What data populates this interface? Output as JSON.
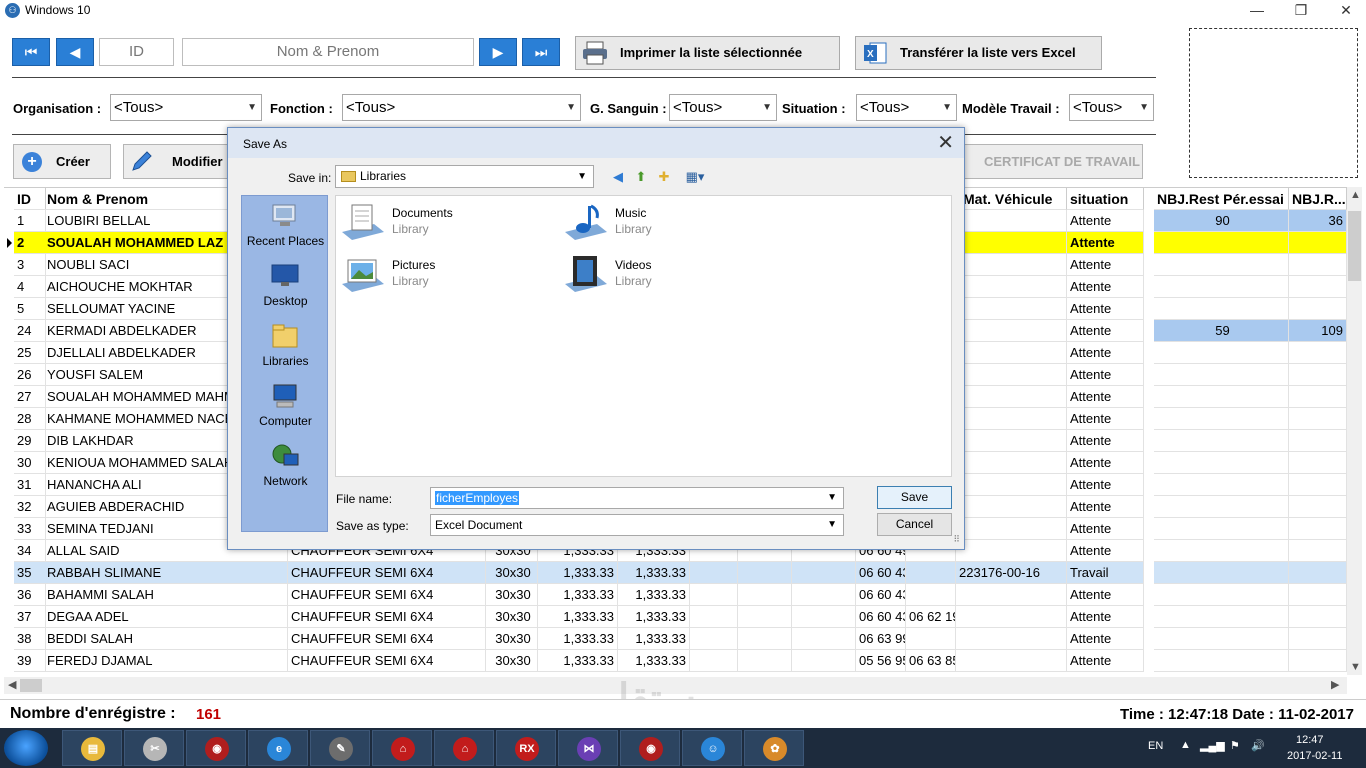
{
  "window": {
    "title": "Windows 10"
  },
  "nav": {
    "id_placeholder": "ID",
    "name_placeholder": "Nom & Prenom"
  },
  "toolbar": {
    "print_label": "Imprimer la liste sélectionnée",
    "excel_label": "Transférer la liste vers Excel"
  },
  "filters": [
    {
      "label": "Organisation :",
      "value": "<Tous>"
    },
    {
      "label": "Fonction :",
      "value": "<Tous>"
    },
    {
      "label": "G. Sanguin :",
      "value": "<Tous>"
    },
    {
      "label": "Situation :",
      "value": "<Tous>"
    },
    {
      "label": "Modèle Travail :",
      "value": "<Tous>"
    }
  ],
  "actions": {
    "create": "Créer",
    "modify": "Modifier",
    "certificate": "CERTIFICAT DE TRAVAIL"
  },
  "grid": {
    "headers": [
      "ID",
      "Nom & Prenom",
      "Mat. Véhicule",
      "situation",
      "NBJ.Rest Pér.essai",
      "NBJ.R..."
    ],
    "rows": [
      {
        "id": "1",
        "name": "LOUBIRI BELLAL",
        "fn": "",
        "size": "",
        "a": "",
        "b": "",
        "tel1": "",
        "tel2": "",
        "mat": "",
        "sit": "Attente",
        "n1": "90",
        "n2": "36"
      },
      {
        "id": "2",
        "name": "SOUALAH MOHAMMED LAZ",
        "fn": "",
        "size": "",
        "a": "",
        "b": "",
        "tel1": "",
        "tel2": "",
        "mat": "",
        "sit": "Attente",
        "n1": "",
        "n2": ""
      },
      {
        "id": "3",
        "name": "NOUBLI  SACI",
        "fn": "",
        "size": "",
        "a": "",
        "b": "",
        "tel1": "",
        "tel2": "",
        "mat": "",
        "sit": "Attente",
        "n1": "",
        "n2": ""
      },
      {
        "id": "4",
        "name": "AICHOUCHE MOKHTAR",
        "fn": "",
        "size": "",
        "a": "",
        "b": "",
        "tel1": "",
        "tel2": "",
        "mat": "",
        "sit": "Attente",
        "n1": "",
        "n2": ""
      },
      {
        "id": "5",
        "name": "SELLOUMAT YACINE",
        "fn": "",
        "size": "",
        "a": "",
        "b": "",
        "tel1": "",
        "tel2": "",
        "mat": "",
        "sit": "Attente",
        "n1": "",
        "n2": ""
      },
      {
        "id": "24",
        "name": "KERMADI  ABDELKADER",
        "fn": "",
        "size": "",
        "a": "",
        "b": "",
        "tel1": "",
        "tel2": "",
        "mat": "",
        "sit": "Attente",
        "n1": "59",
        "n2": "109"
      },
      {
        "id": "25",
        "name": "DJELLALI ABDELKADER",
        "fn": "",
        "size": "",
        "a": "",
        "b": "",
        "tel1": "",
        "tel2": "",
        "mat": "",
        "sit": "Attente",
        "n1": "",
        "n2": ""
      },
      {
        "id": "26",
        "name": "YOUSFI  SALEM",
        "fn": "",
        "size": "",
        "a": "",
        "b": "",
        "tel1": "",
        "tel2": "",
        "mat": "",
        "sit": "Attente",
        "n1": "",
        "n2": ""
      },
      {
        "id": "27",
        "name": "SOUALAH MOHAMMED MAHM",
        "fn": "",
        "size": "",
        "a": "",
        "b": "",
        "tel1": "",
        "tel2": "",
        "mat": "",
        "sit": "Attente",
        "n1": "",
        "n2": ""
      },
      {
        "id": "28",
        "name": "KAHMANE  MOHAMMED NACE",
        "fn": "",
        "size": "",
        "a": "",
        "b": "",
        "tel1": "",
        "tel2": "",
        "mat": "",
        "sit": "Attente",
        "n1": "",
        "n2": ""
      },
      {
        "id": "29",
        "name": "DIB LAKHDAR",
        "fn": "",
        "size": "",
        "a": "",
        "b": "",
        "tel1": "",
        "tel2": "",
        "mat": "",
        "sit": "Attente",
        "n1": "",
        "n2": ""
      },
      {
        "id": "30",
        "name": "KENIOUA MOHAMMED SALAH",
        "fn": "",
        "size": "",
        "a": "",
        "b": "",
        "tel1": "",
        "tel2": "",
        "mat": "",
        "sit": "Attente",
        "n1": "",
        "n2": ""
      },
      {
        "id": "31",
        "name": "HANANCHA ALI",
        "fn": "",
        "size": "",
        "a": "",
        "b": "",
        "tel1": "",
        "tel2": "",
        "mat": "",
        "sit": "Attente",
        "n1": "",
        "n2": ""
      },
      {
        "id": "32",
        "name": "AGUIEB ABDERACHID",
        "fn": "",
        "size": "",
        "a": "",
        "b": "",
        "tel1": "",
        "tel2": "",
        "mat": "",
        "sit": "Attente",
        "n1": "",
        "n2": ""
      },
      {
        "id": "33",
        "name": "SEMINA TEDJANI",
        "fn": "",
        "size": "",
        "a": "",
        "b": "",
        "tel1": "",
        "tel2": "",
        "mat": "",
        "sit": "Attente",
        "n1": "",
        "n2": ""
      },
      {
        "id": "34",
        "name": "ALLAL SAID",
        "fn": "CHAUFFEUR SEMI 6X4",
        "size": "30x30",
        "a": "1,333.33",
        "b": "1,333.33",
        "tel1": "06 60 49",
        "tel2": "",
        "mat": "",
        "sit": "Attente",
        "n1": "",
        "n2": ""
      },
      {
        "id": "35",
        "name": "RABBAH SLIMANE",
        "fn": "CHAUFFEUR SEMI 6X4",
        "size": "30x30",
        "a": "1,333.33",
        "b": "1,333.33",
        "tel1": "06 60 43",
        "tel2": "",
        "mat": "223176-00-16",
        "sit": "Travail",
        "n1": "",
        "n2": ""
      },
      {
        "id": "36",
        "name": "BAHAMMI SALAH",
        "fn": "CHAUFFEUR SEMI 6X4",
        "size": "30x30",
        "a": "1,333.33",
        "b": "1,333.33",
        "tel1": "06 60 43",
        "tel2": "",
        "mat": "",
        "sit": "Attente",
        "n1": "",
        "n2": ""
      },
      {
        "id": "37",
        "name": "DEGAA ADEL",
        "fn": "CHAUFFEUR SEMI 6X4",
        "size": "30x30",
        "a": "1,333.33",
        "b": "1,333.33",
        "tel1": "06 60 43",
        "tel2": "06 62 19",
        "mat": "",
        "sit": "Attente",
        "n1": "",
        "n2": ""
      },
      {
        "id": "38",
        "name": "BEDDI SALAH",
        "fn": "CHAUFFEUR SEMI 6X4",
        "size": "30x30",
        "a": "1,333.33",
        "b": "1,333.33",
        "tel1": "06 63 99",
        "tel2": "",
        "mat": "",
        "sit": "Attente",
        "n1": "",
        "n2": ""
      },
      {
        "id": "39",
        "name": "FEREDJ DJAMAL",
        "fn": "CHAUFFEUR SEMI 6X4",
        "size": "30x30",
        "a": "1,333.33",
        "b": "1,333.33",
        "tel1": "05 56 95",
        "tel2": "06 63 85",
        "mat": "",
        "sit": "Attente",
        "n1": "",
        "n2": ""
      }
    ]
  },
  "status": {
    "count_label": "Nombre d'enrégistre :",
    "count_value": "161",
    "time_text": "Time : 12:47:18  Date : 11-02-2017"
  },
  "dialog": {
    "title": "Save As",
    "save_in_label": "Save in:",
    "save_in_value": "Libraries",
    "places": [
      "Recent Places",
      "Desktop",
      "Libraries",
      "Computer",
      "Network"
    ],
    "libraries": [
      {
        "name": "Documents",
        "type": "Library"
      },
      {
        "name": "Music",
        "type": "Library"
      },
      {
        "name": "Pictures",
        "type": "Library"
      },
      {
        "name": "Videos",
        "type": "Library"
      }
    ],
    "filename_label": "File name:",
    "filename_value": "ficherEmployes",
    "savetype_label": "Save as type:",
    "savetype_value": "Excel Document",
    "save_button": "Save",
    "cancel_button": "Cancel"
  },
  "taskbar": {
    "lang": "EN",
    "clock_time": "12:47",
    "clock_date": "2017-02-11",
    "items": [
      "explorer",
      "snipping",
      "media-player",
      "ie",
      "tools",
      "bank-1",
      "bank-2",
      "rx",
      "visual-studio",
      "media-2",
      "people",
      "paint"
    ]
  },
  "watermark": "مستقل"
}
